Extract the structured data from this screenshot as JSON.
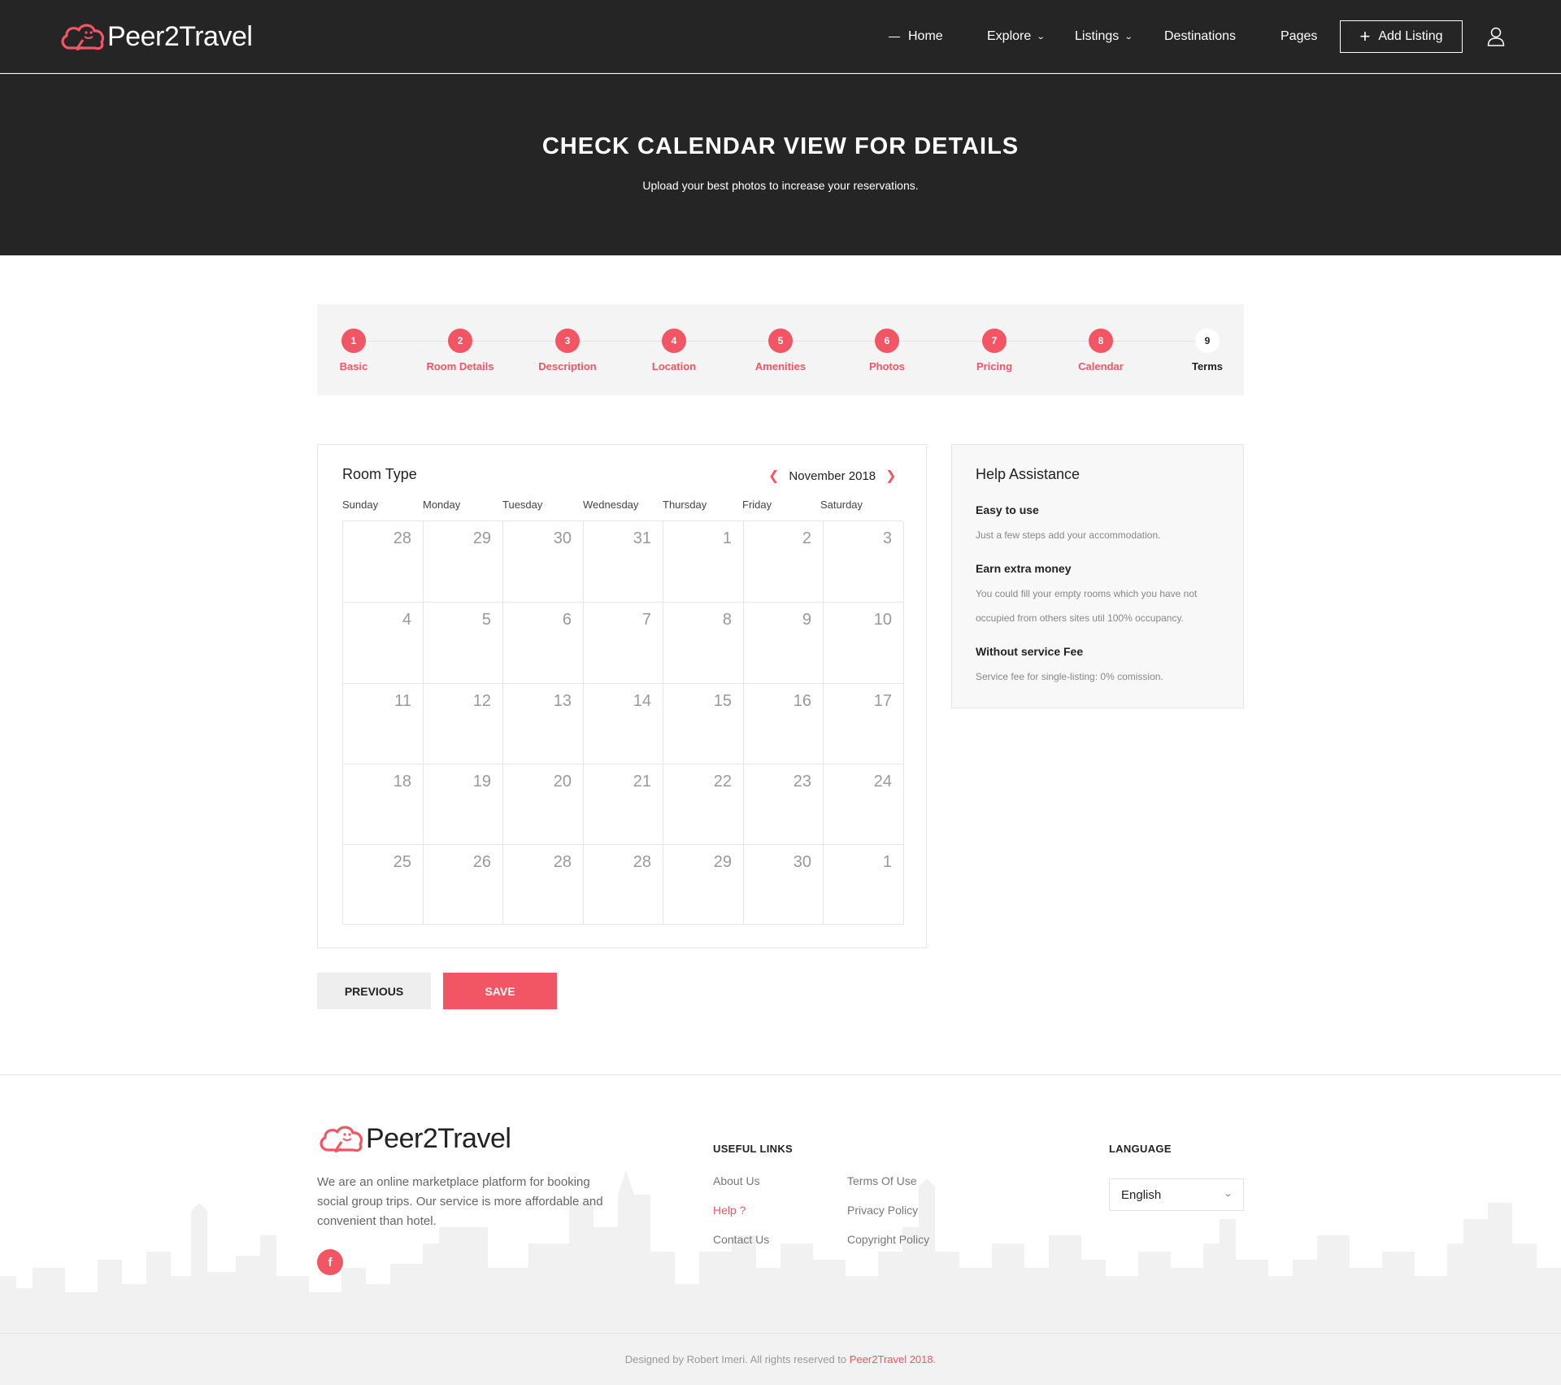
{
  "brand": {
    "name": "Peer2Travel",
    "accent_color": "#f25563",
    "dark_color": "#252525"
  },
  "nav": {
    "items": [
      {
        "label": "Home",
        "has_dash": true,
        "has_dropdown": false
      },
      {
        "label": "Explore",
        "has_dropdown": true
      },
      {
        "label": "Listings",
        "has_dropdown": true
      },
      {
        "label": "Destinations",
        "has_dropdown": false
      },
      {
        "label": "Pages",
        "has_dropdown": false
      }
    ],
    "add_listing_label": "Add Listing",
    "user_icon": "user-icon"
  },
  "hero": {
    "title": "CHECK CALENDAR VIEW FOR DETAILS",
    "subtitle": "Upload your best photos to increase your reservations."
  },
  "steps": [
    {
      "num": "1",
      "label": "Basic",
      "active": true
    },
    {
      "num": "2",
      "label": "Room Details",
      "active": true
    },
    {
      "num": "3",
      "label": "Description",
      "active": true
    },
    {
      "num": "4",
      "label": "Location",
      "active": true
    },
    {
      "num": "5",
      "label": "Amenities",
      "active": true
    },
    {
      "num": "6",
      "label": "Photos",
      "active": true
    },
    {
      "num": "7",
      "label": "Pricing",
      "active": true
    },
    {
      "num": "8",
      "label": "Calendar",
      "active": true
    },
    {
      "num": "9",
      "label": "Terms",
      "active": false
    }
  ],
  "calendar": {
    "title": "Room Type",
    "month": "November 2018",
    "weekdays": [
      "Sunday",
      "Monday",
      "Tuesday",
      "Wednesday",
      "Thursday",
      "Friday",
      "Saturday"
    ],
    "weeks": [
      [
        "28",
        "29",
        "30",
        "31",
        "1",
        "2",
        "3"
      ],
      [
        "4",
        "5",
        "6",
        "7",
        "8",
        "9",
        "10"
      ],
      [
        "11",
        "12",
        "13",
        "14",
        "15",
        "16",
        "17"
      ],
      [
        "18",
        "19",
        "20",
        "21",
        "22",
        "23",
        "24"
      ],
      [
        "25",
        "26",
        "28",
        "28",
        "29",
        "30",
        "1"
      ]
    ]
  },
  "help": {
    "title": "Help Assistance",
    "items": [
      {
        "title": "Easy to use",
        "text": "Just a few steps add your accommodation."
      },
      {
        "title": "Earn extra money",
        "text": "You could fill your empty rooms which you have not occupied from others sites util 100% occupancy."
      },
      {
        "title": "Without service Fee",
        "text": "Service fee for single-listing: 0% comission."
      }
    ]
  },
  "buttons": {
    "previous": "PREVIOUS",
    "save": "SAVE"
  },
  "footer": {
    "about": "We are an online marketplace platform for booking social group trips. Our service is more affordable and convenient than hotel.",
    "facebook_label": "f",
    "useful_links_heading": "USEFUL LINKS",
    "links_col1": [
      "About Us",
      "Help ?",
      "Contact Us"
    ],
    "links_col2": [
      "Terms Of Use",
      "Privacy Policy",
      "Copyright Policy"
    ],
    "active_link": "Help ?",
    "language_heading": "LANGUAGE",
    "language_value": "English",
    "copyright_prefix": "Designed by Robert Imeri. All rights reserved to ",
    "copyright_brand": "Peer2Travel 2018",
    "copyright_suffix": "."
  }
}
